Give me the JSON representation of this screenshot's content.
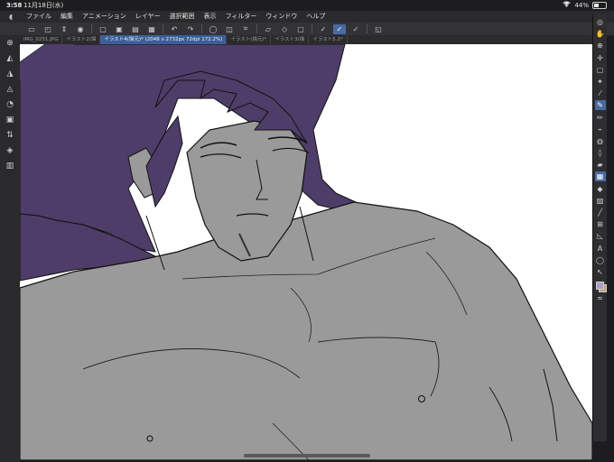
{
  "status_bar": {
    "time": "3:58",
    "date": "11月18日(水)",
    "battery": "44%",
    "battery_level": 0.44
  },
  "menu": {
    "items": [
      "ファイル",
      "編集",
      "アニメーション",
      "レイヤー",
      "選択範囲",
      "表示",
      "フィルター",
      "ウィンドウ",
      "ヘルプ"
    ]
  },
  "tabs": [
    {
      "label": "IMG_0251.JPG",
      "active": false
    },
    {
      "label": "イラスト2(描",
      "active": false
    },
    {
      "label": "イラスト4(描元)* (2048 x 2732px 72dpi 172.2%)",
      "active": true
    },
    {
      "label": "イラスト(描元)*",
      "active": false
    },
    {
      "label": "イラスト3(描",
      "active": false
    },
    {
      "label": "イラスト5.2*",
      "active": false
    }
  ],
  "colors": {
    "hair": "#4e3d68",
    "skin": "#9a9a9a",
    "line": "#111111",
    "accent": "#4a6aa0",
    "main_color": "#b09cc8",
    "sub_color": "#c8a078"
  },
  "icons": {
    "top_toolbar": [
      "new-file-icon",
      "open-icon",
      "stepper-icon",
      "view-icon",
      "separator",
      "clear-icon",
      "fill-icon",
      "open-folder-icon",
      "save-icon",
      "separator",
      "undo-icon",
      "redo-icon",
      "separator",
      "ruler-icon",
      "transform-icon",
      "crop-icon",
      "separator",
      "snap-icon",
      "snap-icon",
      "snap-icon",
      "separator",
      "pen-icon",
      "smooth-pen-icon",
      "edit-pen-icon",
      "separator",
      "paste-icon"
    ],
    "left_toolbar": [
      "search-icon",
      "fill-icon",
      "fill-icon",
      "fill-icon",
      "history-icon",
      "layer-icon",
      "sort-icon",
      "layers-icon",
      "folder-icon"
    ],
    "right_toolbar": [
      "zoom-icon",
      "hand-icon",
      "zoom-icon",
      "move-icon",
      "select-icon",
      "wand-icon",
      "eyedropper-icon",
      "pen-icon",
      "pencil-icon",
      "brush-icon",
      "airbrush-icon",
      "watercolor-icon",
      "eraser-icon",
      "blur-icon",
      "fill-icon",
      "gradient-icon",
      "line-icon",
      "frame-icon",
      "ruler-icon",
      "text-icon",
      "balloon-icon",
      "select-layer-icon",
      "color-icon",
      "wave-icon"
    ]
  }
}
